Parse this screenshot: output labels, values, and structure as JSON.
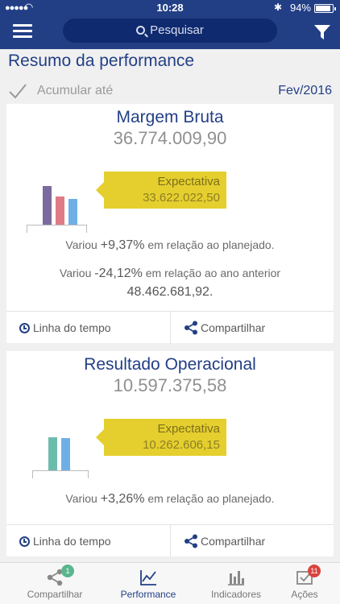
{
  "status_bar": {
    "time": "10:28",
    "battery": "94%"
  },
  "nav": {
    "search_placeholder": "Pesquisar"
  },
  "page": {
    "title": "Resumo da performance",
    "accumulate_label": "Acumular até",
    "period": "Fev/2016"
  },
  "cards": [
    {
      "title": "Margem Bruta",
      "value": "36.774.009,90",
      "expectation_label": "Expectativa",
      "expectation_value": "33.622.022,50",
      "bar_levels": [
        0.85,
        0.62,
        0.58
      ],
      "bar_colors": [
        "#7b6a9e",
        "#e07b86",
        "#6eb0e6"
      ],
      "line1_prefix": "Variou",
      "line1_pct": "+9,37%",
      "line1_suffix": "em relação ao planejado.",
      "line2_prefix": "Variou",
      "line2_pct": "-24,12%",
      "line2_suffix": "em relação ao ano anterior",
      "line3": "48.462.681,92",
      "line3_end": ".",
      "footer_left": "Linha do tempo",
      "footer_right": "Compartilhar"
    },
    {
      "title": "Resultado Operacional",
      "value": "10.597.375,58",
      "expectation_label": "Expectativa",
      "expectation_value": "10.262.606,15",
      "bar_levels": [
        0.73,
        0.71
      ],
      "bar_colors": [
        "#6cbcae",
        "#6eb0e6"
      ],
      "line1_prefix": "Variou",
      "line1_pct": "+3,26%",
      "line1_suffix": "em relação ao planejado.",
      "footer_left": "Linha do tempo",
      "footer_right": "Compartilhar"
    }
  ],
  "tabbar": {
    "tabs": [
      {
        "label": "Compartilhar",
        "badge": "1",
        "badge_color": "#5ab68e",
        "icon": "share-icon"
      },
      {
        "label": "Performance",
        "active": true,
        "icon": "line-chart-icon"
      },
      {
        "label": "Indicadores",
        "icon": "bar-chart-icon"
      },
      {
        "label": "Ações",
        "badge": "11",
        "badge_color": "#d9443f",
        "icon": "actions-icon"
      }
    ]
  },
  "colors": {
    "primary": "#223f86",
    "tooltip": "#e5cf2e"
  }
}
